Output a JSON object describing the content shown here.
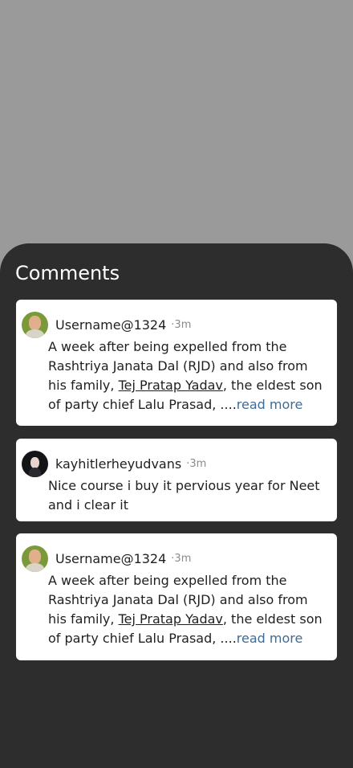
{
  "title": "Comments",
  "comments": [
    {
      "username": "Username@1324",
      "dot": "·",
      "time": "3m",
      "text_a": "A week after being expelled from the Rashtriya Janata Dal (RJD) and also from his family, ",
      "link": "Tej Pratap Yadav",
      "text_b": ", the eldest son  of party chief Lalu Prasad, ....",
      "more": "read more"
    },
    {
      "username": "kayhitlerheyudvans",
      "dot": "·",
      "time": "3m",
      "text_a": "Nice course i buy it pervious year for Neet and i clear it"
    },
    {
      "username": "Username@1324",
      "dot": "·",
      "time": "3m",
      "text_a": "A week after being expelled from the Rashtriya Janata Dal (RJD) and also from his family, ",
      "link": "Tej Pratap Yadav",
      "text_b": ", the eldest son  of party chief Lalu Prasad, ....",
      "more": "read more"
    }
  ]
}
